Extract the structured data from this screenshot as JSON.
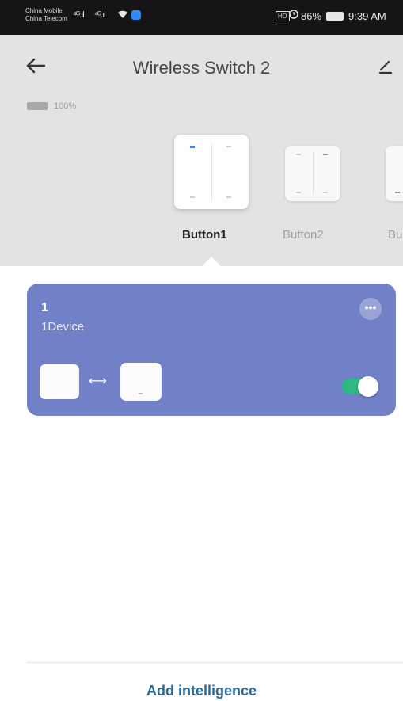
{
  "status_bar": {
    "carrier1": "China Mobile",
    "carrier2": "China Telecom",
    "signal1": "⁴ᴳ.ıl",
    "signal2": "⁴ᴳ.ıl",
    "wifi_icon": "wifi-icon",
    "hd_label": "HD",
    "alarm_icon": "alarm-icon",
    "battery_text": "86%",
    "time": "9:39 AM"
  },
  "header": {
    "title": "Wireless Switch 2",
    "back_icon": "arrow-left-icon",
    "edit_icon": "pencil-icon",
    "battery_level": "100%"
  },
  "buttons": [
    {
      "label": "Button1",
      "selected": true
    },
    {
      "label": "Button2",
      "selected": false
    },
    {
      "label": "Bu",
      "selected": false
    }
  ],
  "card": {
    "number": "1",
    "subtitle": "1Device",
    "more_icon": "more-icon",
    "more_text": "•••",
    "link_icon": "link-arrow-icon",
    "link_text": "⟷",
    "toggle_on": true,
    "color": "#7281c7",
    "toggle_color": "#2cba83"
  },
  "footer": {
    "add_label": "Add intelligence"
  }
}
